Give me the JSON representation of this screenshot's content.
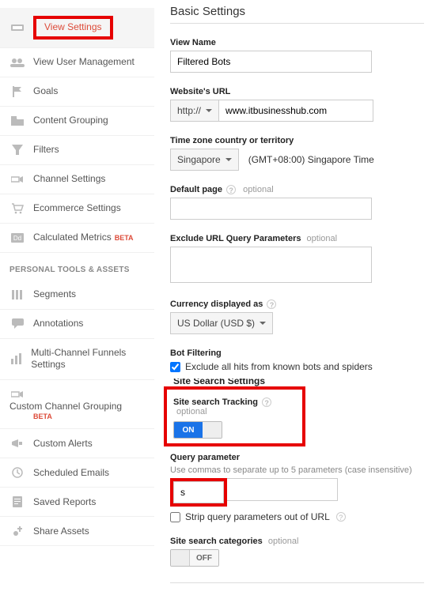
{
  "sidebar": {
    "items": [
      {
        "label": "View Settings"
      },
      {
        "label": "View User Management"
      },
      {
        "label": "Goals"
      },
      {
        "label": "Content Grouping"
      },
      {
        "label": "Filters"
      },
      {
        "label": "Channel Settings"
      },
      {
        "label": "Ecommerce Settings"
      },
      {
        "label": "Calculated Metrics",
        "beta": "BETA"
      }
    ],
    "personal_header": "PERSONAL TOOLS & ASSETS",
    "personal": [
      {
        "label": "Segments"
      },
      {
        "label": "Annotations"
      },
      {
        "label": "Multi-Channel Funnels Settings"
      },
      {
        "label": "Custom Channel Grouping",
        "beta": "BETA"
      },
      {
        "label": "Custom Alerts"
      },
      {
        "label": "Scheduled Emails"
      },
      {
        "label": "Saved Reports"
      },
      {
        "label": "Share Assets"
      }
    ]
  },
  "main": {
    "title": "Basic Settings",
    "view_name": {
      "label": "View Name",
      "value": "Filtered Bots"
    },
    "website_url": {
      "label": "Website's URL",
      "protocol": "http://",
      "value": "www.itbusinesshub.com"
    },
    "timezone": {
      "label": "Time zone country or territory",
      "country": "Singapore",
      "text": "(GMT+08:00) Singapore Time"
    },
    "default_page": {
      "label": "Default page",
      "optional": "optional",
      "value": ""
    },
    "exclude_params": {
      "label": "Exclude URL Query Parameters",
      "optional": "optional",
      "value": ""
    },
    "currency": {
      "label": "Currency displayed as",
      "value": "US Dollar (USD $)"
    },
    "bot": {
      "label": "Bot Filtering",
      "checkbox_label": "Exclude all hits from known bots and spiders",
      "checked": true
    },
    "site_search_settings_header": "Site Search Settings",
    "site_search": {
      "label": "Site search Tracking",
      "optional": "optional",
      "state": "ON"
    },
    "query_param": {
      "label": "Query parameter",
      "note": "Use commas to separate up to 5 parameters (case insensitive)",
      "value": "s",
      "strip_label": "Strip query parameters out of URL",
      "strip_checked": false
    },
    "categories": {
      "label": "Site search categories",
      "optional": "optional",
      "state": "OFF"
    }
  }
}
